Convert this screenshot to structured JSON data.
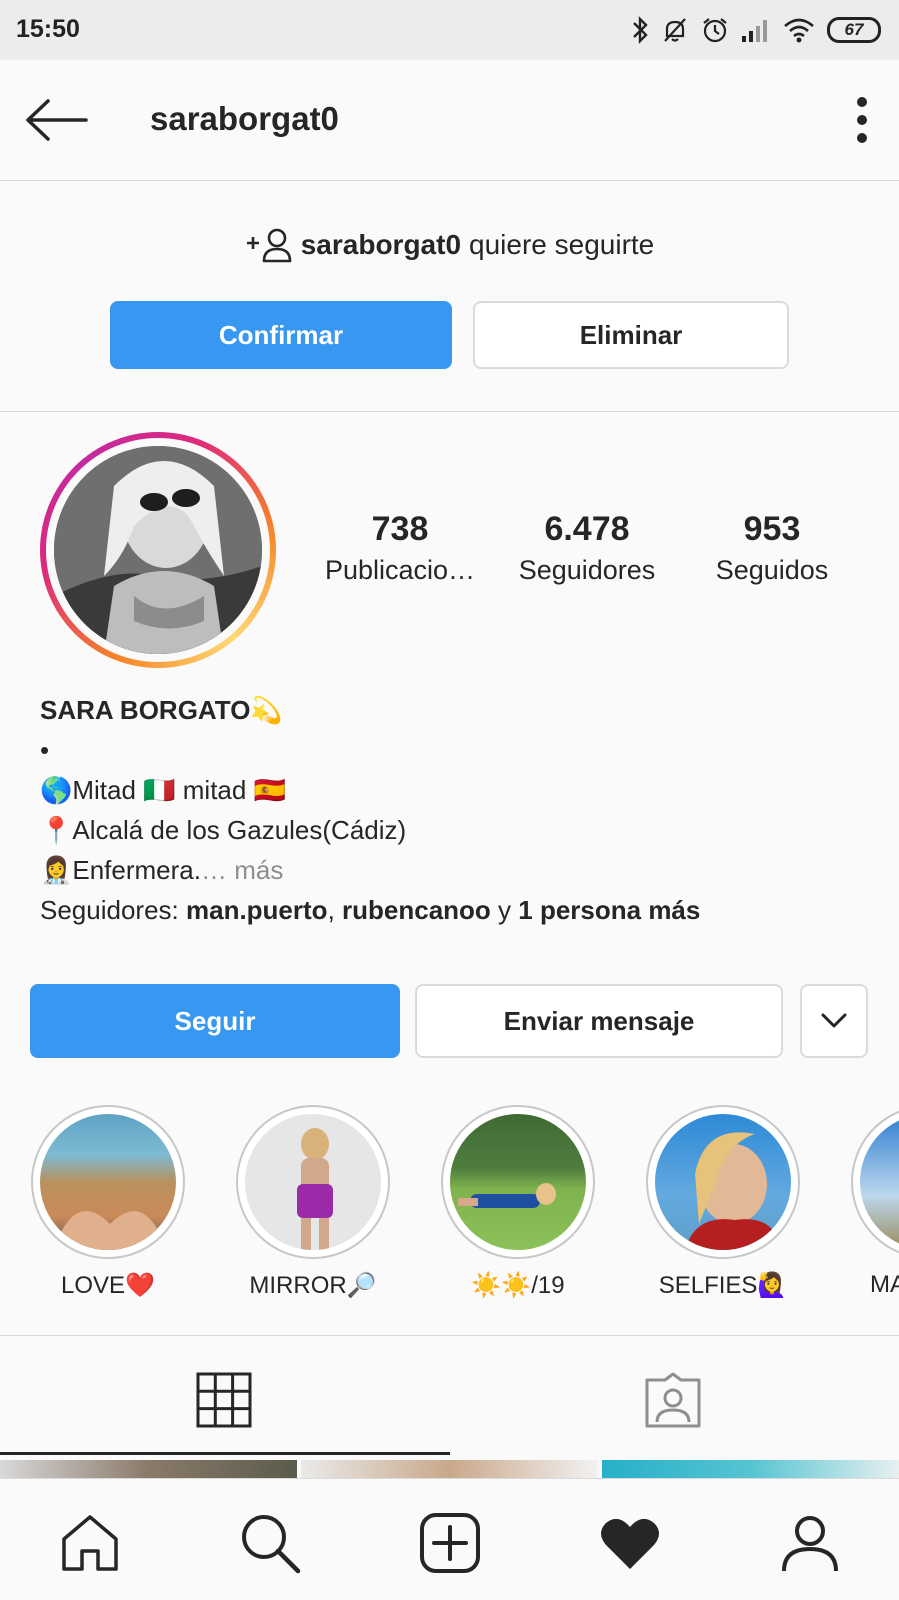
{
  "status_bar": {
    "time": "15:50",
    "battery": "67",
    "icons": [
      "bluetooth-icon",
      "mute-icon",
      "alarm-icon",
      "signal-icon",
      "wifi-icon",
      "battery-icon"
    ]
  },
  "app_bar": {
    "username": "saraborgat0",
    "back_icon": "arrow-left-icon",
    "menu_icon": "more-vertical-icon"
  },
  "follow_request": {
    "username": "saraborgat0",
    "message": "quiere seguirte",
    "confirm_label": "Confirmar",
    "delete_label": "Eliminar"
  },
  "profile": {
    "stats": [
      {
        "value": "738",
        "label": "Publicacio…"
      },
      {
        "value": "6.478",
        "label": "Seguidores"
      },
      {
        "value": "953",
        "label": "Seguidos"
      }
    ],
    "display_name": "SARA BORGATO💫",
    "bio_lines": [
      "•",
      "🌎Mitad 🇮🇹 mitad 🇪🇸",
      "📍Alcalá de los Gazules(Cádiz)",
      "👩‍⚕️Enfermera."
    ],
    "more_label": "… más",
    "followers_prefix": "Seguidores: ",
    "followers_1": "man.puerto",
    "followers_sep": ", ",
    "followers_2": "rubencanoo",
    "followers_and": " y ",
    "followers_more": "1 persona más"
  },
  "actions": {
    "follow_label": "Seguir",
    "message_label": "Enviar mensaje",
    "dropdown_icon": "chevron-down-icon"
  },
  "highlights": [
    {
      "label": "LOVE❤️"
    },
    {
      "label": "MIRROR🔎"
    },
    {
      "label": "☀️☀️/19"
    },
    {
      "label": "SELFIES🙋‍♀️"
    },
    {
      "label": "MA"
    }
  ],
  "tabs": {
    "grid_icon": "grid-icon",
    "tagged_icon": "tagged-photos-icon",
    "active": "grid"
  },
  "bottom_nav": [
    "home-icon",
    "search-icon",
    "add-post-icon",
    "heart-icon",
    "profile-icon"
  ],
  "colors": {
    "accent": "#3897f0",
    "text": "#262626",
    "muted": "#8e8e8e",
    "border": "#dbdbdb"
  }
}
